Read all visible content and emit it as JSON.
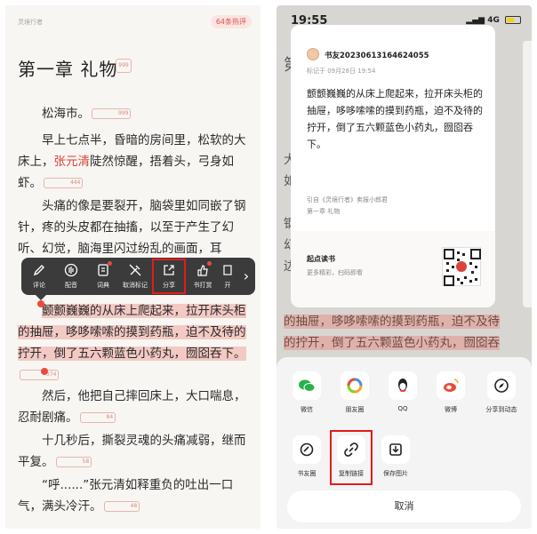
{
  "left": {
    "book_name": "灵境行者",
    "comment_count": "64条热评",
    "chapter_title": "第一章 礼物",
    "chapter_badge": "999",
    "paragraphs": [
      {
        "text": "松海市。",
        "badge": "999"
      },
      {
        "text_a": "早上七点半，昏暗的房间里，松软的大床上，",
        "red": "张元清",
        "text_b": "陡然惊醒，捂着头，弓身如虾。",
        "badge": "444"
      },
      {
        "text": "头痛的像是要裂开，脑袋里如同嵌了钢针，疼的头皮都在抽搐，以至于产生了幻听、幻觉，脑海里闪过纷乱的画面，耳",
        "badge": ""
      },
      {
        "text": "颤颤巍巍的从床上爬起来，拉开床头柜的抽屉，哆哆嗦嗦的摸到药瓶，迫不及待的拧开，倒了五六颗蓝色小药丸，囫囵吞下。",
        "badge": "374"
      },
      {
        "text": "然后，他把自己摔回床上，大口喘息，忍耐剧痛。",
        "badge": "84"
      },
      {
        "text": "十几秒后，撕裂灵魂的头痛减弱，继而平复。",
        "badge": "58"
      },
      {
        "text": "“呼......”张元清如释重负的吐出一口气，满头冷汗。",
        "badge": "48"
      }
    ],
    "toolbar": [
      {
        "label": "评论",
        "icon": "pen-icon"
      },
      {
        "label": "配音",
        "icon": "voice-icon"
      },
      {
        "label": "词典",
        "icon": "dictionary-icon"
      },
      {
        "label": "取消标记",
        "icon": "unmark-icon"
      },
      {
        "label": "分享",
        "icon": "share-icon"
      },
      {
        "label": "书打赏",
        "icon": "reward-icon"
      },
      {
        "label": "开",
        "icon": "open-icon"
      }
    ],
    "toolbar_more": "›"
  },
  "right": {
    "status": {
      "time": "19:55",
      "network": "4G"
    },
    "card": {
      "user": "书友20230613164624055",
      "date": "标记于 09月28日 19:54",
      "quote": "颤颤巍巍的从床上爬起来，拉开床头柜的抽屉，哆哆嗦嗦的摸到药瓶，迫不及待的拧开，倒了五六颗蓝色小药丸，囫囵吞下。",
      "source": "引自《灵境行者》卖报小郎君",
      "chapter": "第一章 礼物",
      "brand": "起点读书",
      "brand_sub": "更多精彩，扫码即看"
    },
    "bg_lines": [
      "第",
      "大",
      "如",
      "钢",
      "幻",
      "边",
      "的抽屉，哆哆嗦嗦的摸到药瓶，迫不及待",
      "的拧开，倒了五六颗蓝色小药丸，囫囵吞"
    ],
    "share_row1": [
      {
        "label": "微信",
        "icon": "wechat-icon"
      },
      {
        "label": "朋友圈",
        "icon": "moments-icon"
      },
      {
        "label": "QQ",
        "icon": "qq-icon"
      },
      {
        "label": "微博",
        "icon": "weibo-icon"
      },
      {
        "label": "分享到动态",
        "icon": "compass-icon"
      }
    ],
    "share_row2": [
      {
        "label": "书友圈",
        "icon": "bookfriend-icon"
      },
      {
        "label": "复制链接",
        "icon": "link-icon"
      },
      {
        "label": "保存图片",
        "icon": "save-image-icon"
      }
    ],
    "cancel": "取消"
  }
}
